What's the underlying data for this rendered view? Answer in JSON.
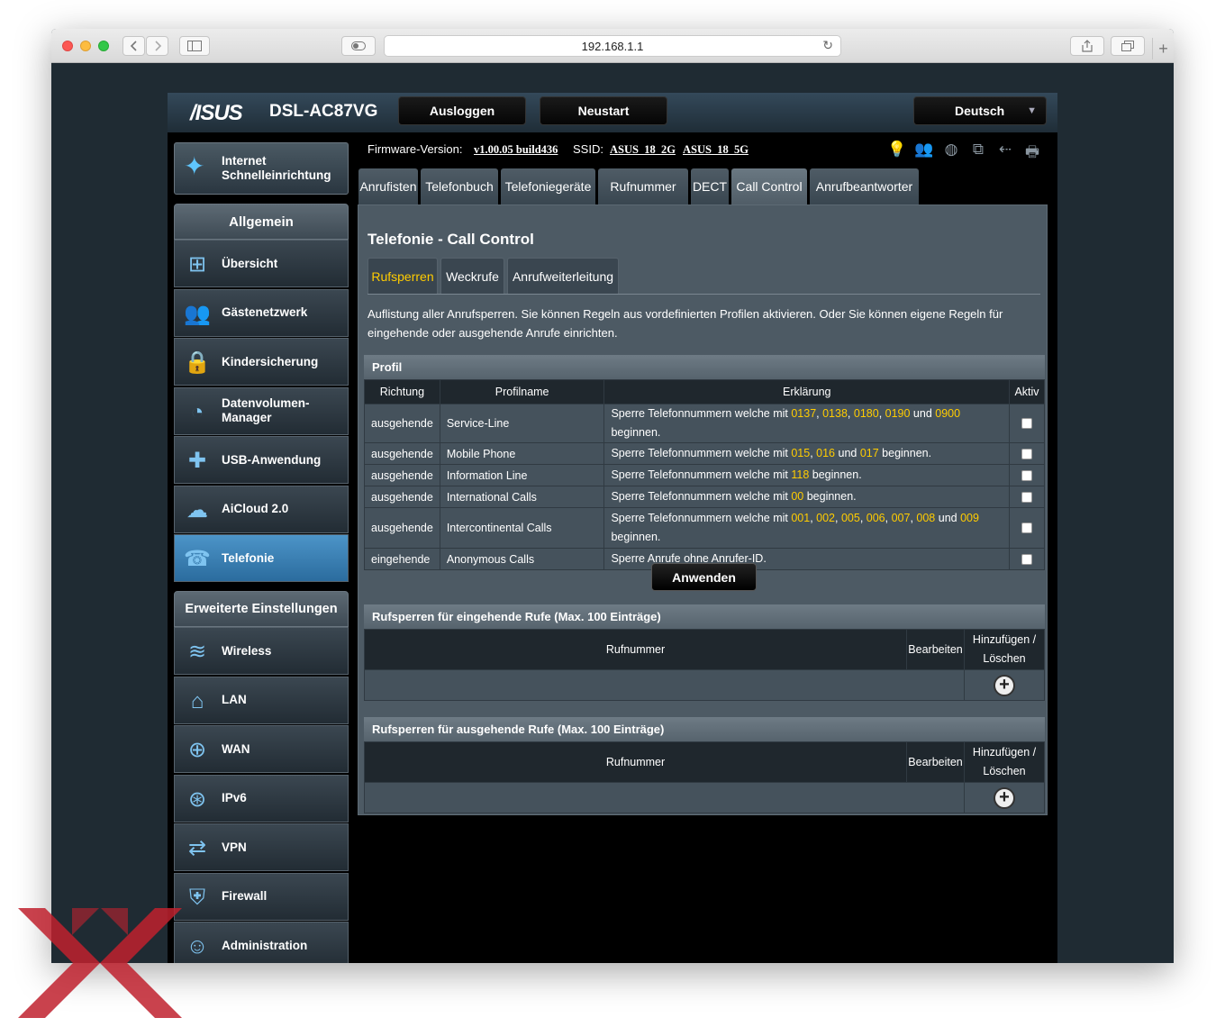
{
  "browser": {
    "url": "192.168.1.1",
    "back_icon": "chevron-left-icon",
    "forward_icon": "chevron-right-icon",
    "sidebar_icon": "sidebar-icon",
    "reader_icon": "reader-icon",
    "reload_icon": "reload-icon",
    "share_icon": "share-icon",
    "tabs_icon": "tabs-icon",
    "newtab_label": "+"
  },
  "header": {
    "logo": "/ISUS",
    "model": "DSL-AC87VG",
    "logout": "Ausloggen",
    "restart": "Neustart",
    "language": "Deutsch"
  },
  "quick_setup": {
    "label": "Internet Schnelleinrichtung"
  },
  "sidebar": {
    "general_title": "Allgemein",
    "general_items": [
      {
        "label": "Übersicht",
        "icon": "network-map-icon"
      },
      {
        "label": "Gästenetzwerk",
        "icon": "guest-network-icon"
      },
      {
        "label": "Kindersicherung",
        "icon": "lock-icon"
      },
      {
        "label": "Datenvolumen-Manager",
        "icon": "speedometer-icon"
      },
      {
        "label": "USB-Anwendung",
        "icon": "puzzle-icon"
      },
      {
        "label": "AiCloud 2.0",
        "icon": "cloud-icon"
      },
      {
        "label": "Telefonie",
        "icon": "phone-icon"
      }
    ],
    "advanced_title": "Erweiterte Einstellungen",
    "advanced_items": [
      {
        "label": "Wireless",
        "icon": "wifi-icon"
      },
      {
        "label": "LAN",
        "icon": "home-icon"
      },
      {
        "label": "WAN",
        "icon": "globe-icon"
      },
      {
        "label": "IPv6",
        "icon": "ipv6-globe-icon"
      },
      {
        "label": "VPN",
        "icon": "vpn-icon"
      },
      {
        "label": "Firewall",
        "icon": "shield-icon"
      },
      {
        "label": "Administration",
        "icon": "user-icon"
      }
    ]
  },
  "info": {
    "firmware_label": "Firmware-Version:",
    "firmware_value": "v1.00.05 build436",
    "ssid_label": "SSID:",
    "ssid_2g": "ASUS_18_2G",
    "ssid_5g": "ASUS_18_5G"
  },
  "tabs": [
    "Anrufisten",
    "Telefonbuch",
    "Telefoniegeräte",
    "Rufnummer",
    "DECT",
    "Call Control",
    "Anrufbeantworter"
  ],
  "panel": {
    "title": "Telefonie - Call Control",
    "subtabs": [
      "Rufsperren",
      "Weckrufe",
      "Anrufweiterleitung"
    ],
    "description": "Auflistung aller Anrufsperren. Sie können Regeln aus vordefinierten Profilen aktivieren. Oder Sie können eigene Regeln für eingehende oder ausgehende Anrufe einrichten.",
    "profile_title": "Profil",
    "profile_headers": [
      "Richtung",
      "Profilname",
      "Erklärung",
      "Aktiv"
    ],
    "profile_rows": [
      {
        "dir": "ausgehende",
        "name": "Service-Line",
        "text_a": "Sperre Telefonnummern welche mit ",
        "n1": "0137",
        "s1": ", ",
        "n2": "0138",
        "s2": ", ",
        "n3": "0180",
        "s3": ", ",
        "n4": "0190",
        "s4": " und ",
        "n5": "0900",
        "text_b": " beginnen."
      },
      {
        "dir": "ausgehende",
        "name": "Mobile Phone",
        "text_a": "Sperre Telefonnummern welche mit ",
        "n1": "015",
        "s1": ", ",
        "n2": "016",
        "s2": " und ",
        "n3": "017",
        "text_b": " beginnen."
      },
      {
        "dir": "ausgehende",
        "name": "Information Line",
        "text_a": "Sperre Telefonnummern welche mit ",
        "n1": "118",
        "text_b": " beginnen."
      },
      {
        "dir": "ausgehende",
        "name": "International Calls",
        "text_a": "Sperre Telefonnummern welche mit ",
        "n1": "00",
        "text_b": " beginnen."
      },
      {
        "dir": "ausgehende",
        "name": "Intercontinental Calls",
        "text_a": "Sperre Telefonnummern welche mit ",
        "n1": "001",
        "s1": ", ",
        "n2": "002",
        "s2": ", ",
        "n3": "005",
        "s3": ", ",
        "n4": "006",
        "s4": ", ",
        "n5": "007",
        "s5": ", ",
        "n6": "008",
        "s6": " und ",
        "n7": "009",
        "text_b": " beginnen."
      },
      {
        "dir": "eingehende",
        "name": "Anonymous Calls",
        "text_a": "Sperre Anrufe ohne Anrufer-ID."
      }
    ],
    "apply": "Anwenden",
    "incoming_title": "Rufsperren für eingehende Rufe (Max. 100 Einträge)",
    "outgoing_title": "Rufsperren für ausgehende Rufe (Max. 100 Einträge)",
    "col_number": "Rufnummer",
    "col_edit": "Bearbeiten",
    "col_add": "Hinzufügen / Löschen",
    "add_symbol": "+"
  }
}
